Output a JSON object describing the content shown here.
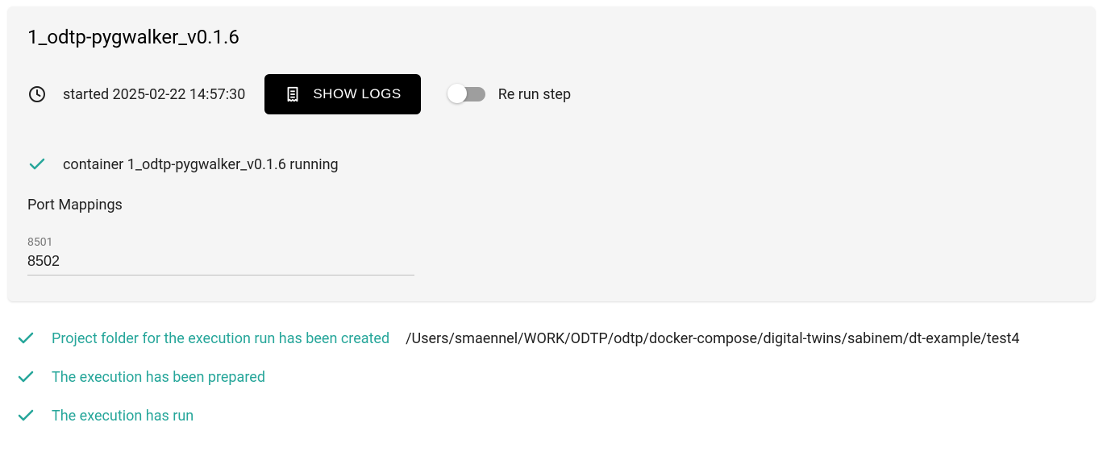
{
  "card": {
    "title": "1_odtp-pygwalker_v0.1.6",
    "started_text": "started 2025-02-22 14:57:30",
    "show_logs_label": "SHOW LOGS",
    "rerun_label": "Re run step",
    "container_status": "container 1_odtp-pygwalker_v0.1.6 running",
    "port_heading": "Port Mappings",
    "port_label": "8501",
    "port_value": "8502"
  },
  "status_items": [
    {
      "green_text": "Project folder for the execution run has been created",
      "black_text": "/Users/smaennel/WORK/ODTP/odtp/docker-compose/digital-twins/sabinem/dt-example/test4"
    },
    {
      "green_text": "The execution has been prepared",
      "black_text": ""
    },
    {
      "green_text": "The execution has run",
      "black_text": ""
    }
  ],
  "colors": {
    "teal": "#26a69a",
    "grey_track": "#9e9e9e"
  }
}
